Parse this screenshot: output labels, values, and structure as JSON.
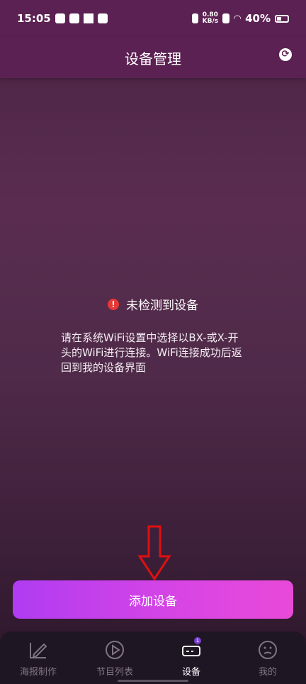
{
  "status_bar": {
    "time": "15:05",
    "net_speed_value": "0.80",
    "net_speed_unit": "KB/s",
    "battery": "40%"
  },
  "header": {
    "title": "设备管理",
    "refresh_icon": "refresh-icon"
  },
  "notice": {
    "icon": "error-icon",
    "text": "未检测到设备"
  },
  "instruction": "请在系统WiFi设置中选择以BX-或X-开头的WiFi进行连接。WiFi连接成功后返回到我的设备界面",
  "add_button": {
    "label": "添加设备"
  },
  "tabs": [
    {
      "label": "海报制作",
      "icon": "pencil-icon",
      "active": false
    },
    {
      "label": "节目列表",
      "icon": "play-icon",
      "active": false
    },
    {
      "label": "设备",
      "icon": "device-icon",
      "active": true
    },
    {
      "label": "我的",
      "icon": "face-icon",
      "active": false
    }
  ],
  "colors": {
    "header_bg": "#5b2152",
    "button_gradient_start": "#b03cf2",
    "button_gradient_end": "#e84ad8",
    "error": "#e53935",
    "arrow": "#e01010"
  }
}
